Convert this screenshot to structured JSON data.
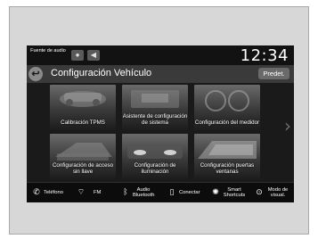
{
  "status_bar": {
    "audio_source_label": "Fuente de audio",
    "clock": "12:34"
  },
  "header": {
    "title": "Configuración Vehículo",
    "preset_label": "Predet."
  },
  "tiles": [
    {
      "label": "Calibración TPMS"
    },
    {
      "label": "Asistente de configuración de sistema"
    },
    {
      "label": "Configuración del medidor"
    },
    {
      "label": "Configuración de acceso sin llave"
    },
    {
      "label": "Configuración de iluminación"
    },
    {
      "label": "Configuración puertas ventanas"
    }
  ],
  "bottom_bar": {
    "items": [
      {
        "label": "Teléfono",
        "icon": "phone-icon"
      },
      {
        "label": "FM",
        "icon": "radio-icon"
      },
      {
        "label": "Audio Bluetooth",
        "icon": "bluetooth-icon"
      },
      {
        "label": "Conectar",
        "icon": "smartphone-icon"
      },
      {
        "label": "Smart Shortcuts",
        "icon": "shortcut-icon"
      },
      {
        "label": "Modo de visual.",
        "icon": "display-mode-icon"
      }
    ]
  },
  "colors": {
    "screen_background": "#1a1a1a",
    "title_bar": "#3a3a3a",
    "accent_button": "#6a6a6a"
  }
}
